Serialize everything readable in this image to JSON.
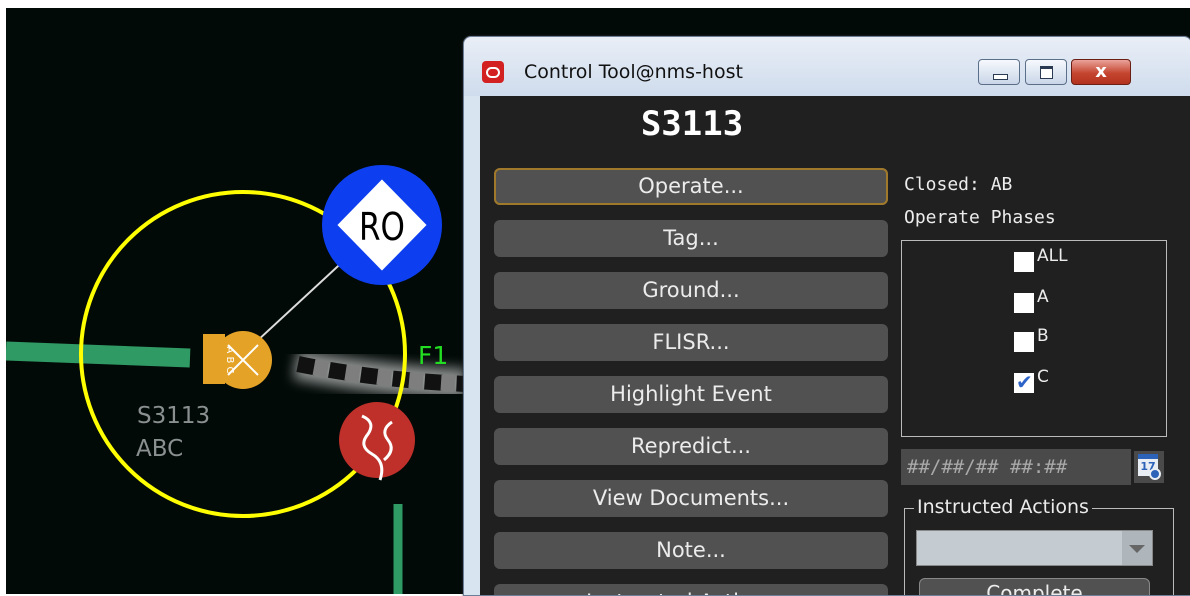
{
  "map": {
    "badge_label": "RO",
    "feeder_label": "F1",
    "device_name": "S3113",
    "device_phases": "ABC",
    "device_tag_text": "A B C"
  },
  "window": {
    "title": "Control Tool@nms-host",
    "close_glyph": "x"
  },
  "panel": {
    "device_title": "S3113",
    "actions": [
      "Operate...",
      "Tag...",
      "Ground...",
      "FLISR...",
      "Highlight Event",
      "Repredict...",
      "View Documents...",
      "Note...",
      "Instructed Actions..."
    ],
    "closed_status": "Closed: AB",
    "operate_phases_label": "Operate Phases",
    "phases": [
      {
        "label": "ALL",
        "checked": false
      },
      {
        "label": "A",
        "checked": false
      },
      {
        "label": "B",
        "checked": false
      },
      {
        "label": "C",
        "checked": true
      }
    ],
    "datetime_placeholder": "##/##/## ##:##",
    "calendar_glyph": "17",
    "instructed_actions_label": "Instructed Actions",
    "instructed_actions_value": "",
    "complete_label": "Complete"
  },
  "colors": {
    "map_background": "#020a08",
    "selection_ring": "#ffff00",
    "badge_blue": "#0d3ff0",
    "device_orange": "#e4a227",
    "feeder_green": "#2f9a64",
    "label_green": "#22dd22",
    "warning_red": "#c0302a",
    "panel_background": "#202020",
    "button_gray": "#515151",
    "checkbox_blue": "#2e63c8"
  }
}
